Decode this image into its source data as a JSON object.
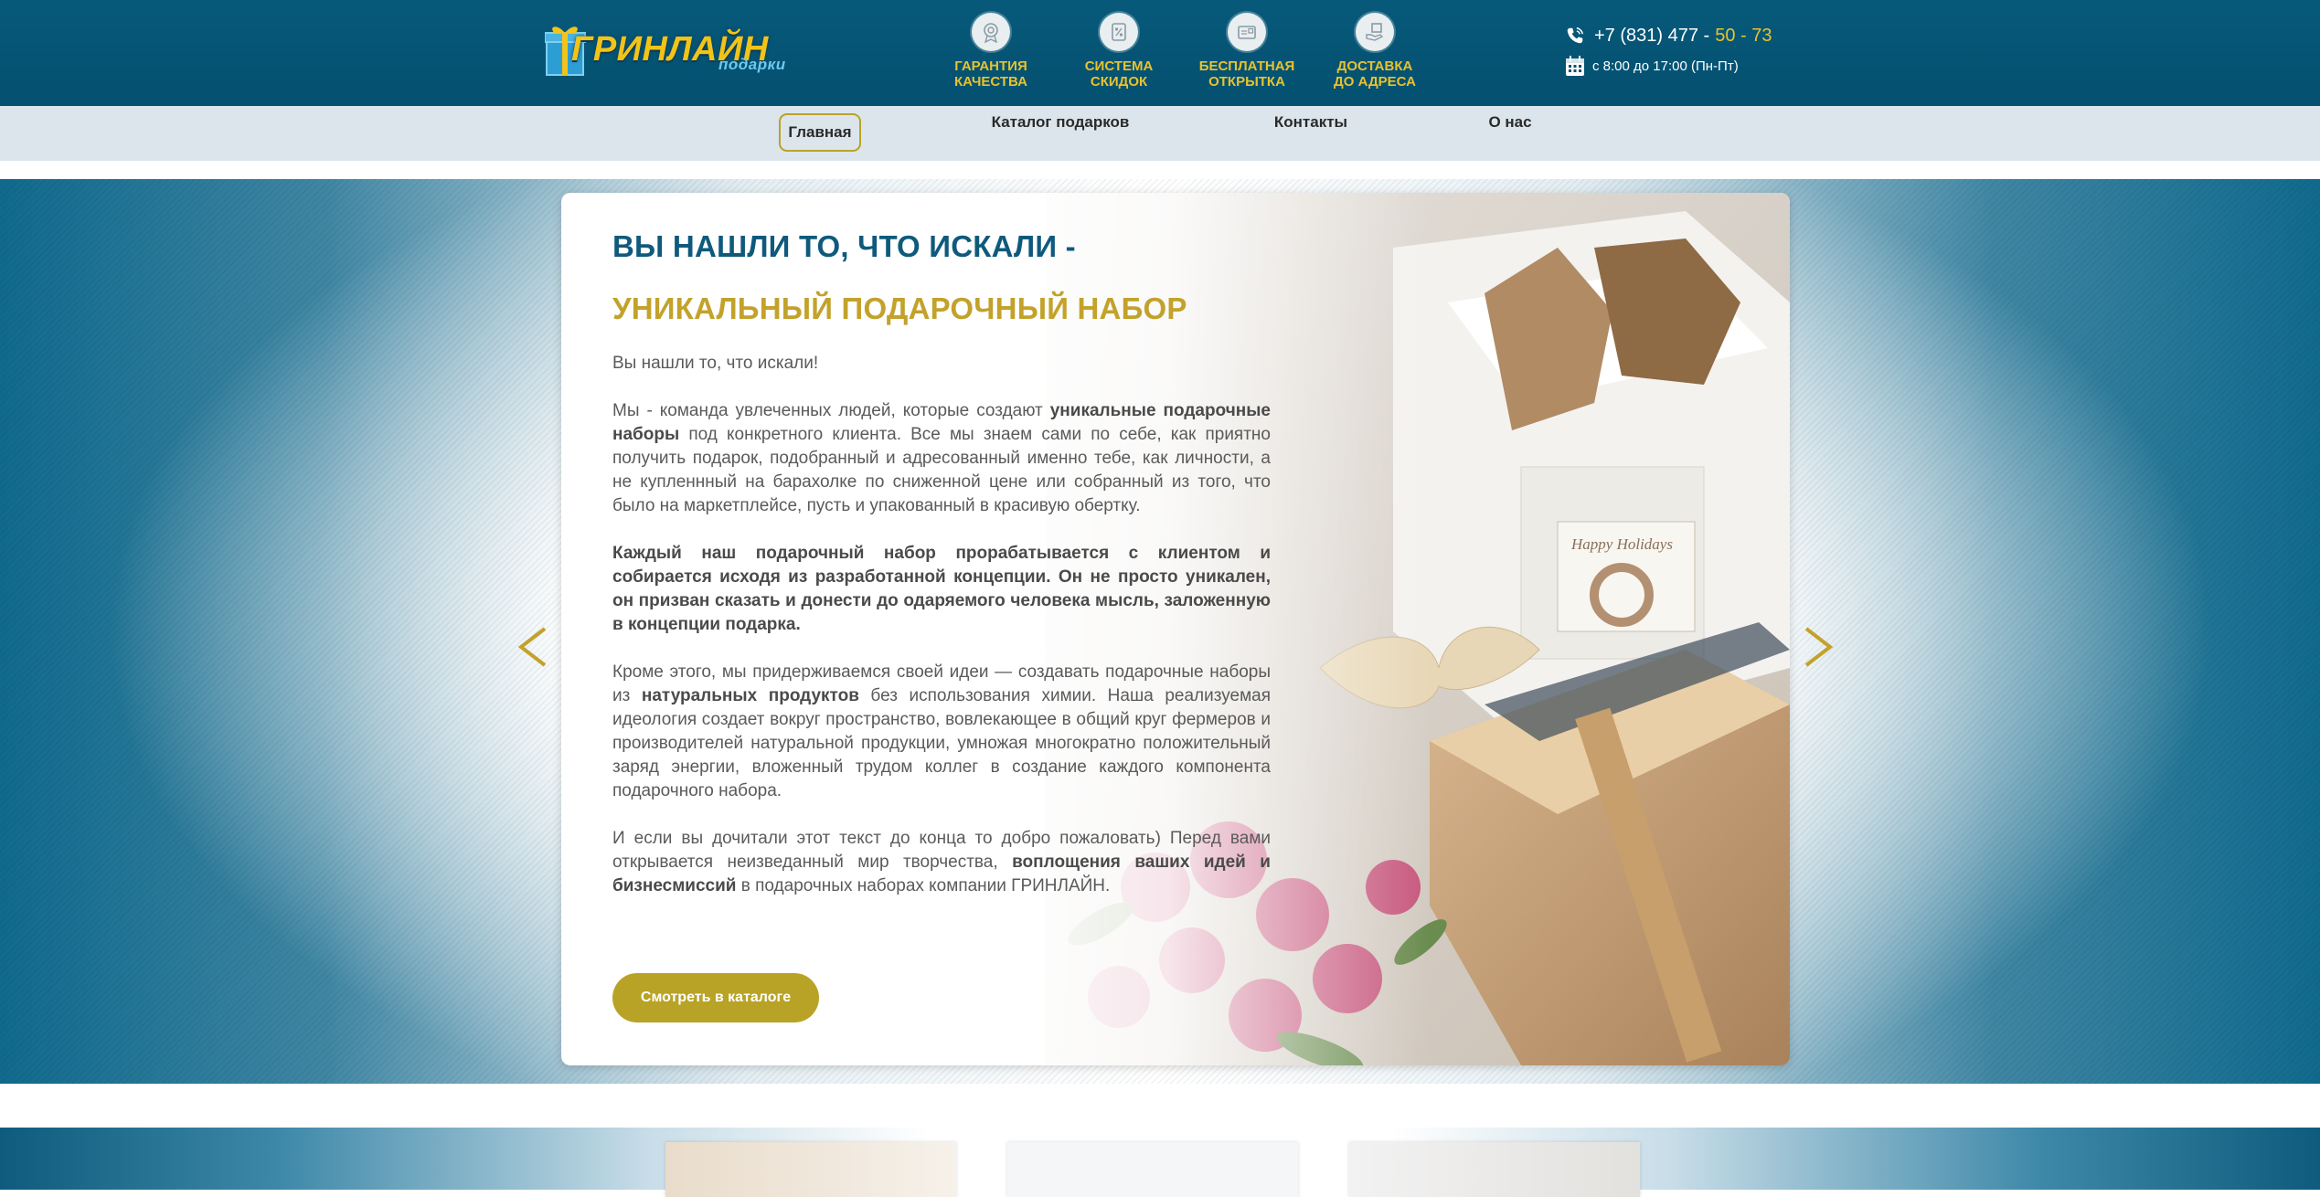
{
  "brand": {
    "logo_main": "ГРИНЛАЙН",
    "logo_sub": "подарки"
  },
  "features": [
    {
      "label": "ГАРАНТИЯ\nКАЧЕСТВА",
      "icon": "quality-badge-icon"
    },
    {
      "label": "СИСТЕМА\nСКИДОК",
      "icon": "discount-percent-icon"
    },
    {
      "label": "БЕСПЛАТНАЯ\nОТКРЫТКА",
      "icon": "postcard-icon"
    },
    {
      "label": "ДОСТАВКА\nДО АДРЕСА",
      "icon": "delivery-hand-icon"
    }
  ],
  "contact": {
    "phone_main": "+7 (831) 477 -",
    "phone_accent": "50 - 73",
    "hours": "с 8:00 до 17:00 (Пн-Пт)"
  },
  "nav": {
    "items": [
      {
        "label": "Главная",
        "active": true
      },
      {
        "label": "Каталог подарков",
        "active": false
      },
      {
        "label": "Контакты",
        "active": false
      },
      {
        "label": "О нас",
        "active": false
      }
    ]
  },
  "hero": {
    "title_line1": "ВЫ НАШЛИ ТО, ЧТО ИСКАЛИ -",
    "title_line2": "УНИКАЛЬНЫЙ ПОДАРОЧНЫЙ НАБОР",
    "intro": "Вы нашли то, что искали!",
    "p1_a": "Мы - команда увлеченных людей, которые создают ",
    "p1_b": "уникальные подарочные наборы",
    "p1_c": " под конкретного клиента. Все мы знаем сами по себе, как приятно получить подарок, подобранный и адресованный именно тебе, как личности, а не купленнный на барахолке по сниженной цене или собранный из того, что было на маркетплейсе, пусть и упакованный в красивую обертку.",
    "p2": "Каждый наш подарочный набор прорабатывается с клиентом и собирается исходя из разработанной концепции. Он не просто уникален, он призван сказать и донести до одаряемого человека мысль, заложенную в концепции подарка.",
    "p3_a": "Кроме этого, мы придерживаемся своей идеи  — создавать подарочные наборы из ",
    "p3_b": "натуральных продуктов",
    "p3_c": " без использования химии. Наша реализуемая идеология создает вокруг пространство, вовлекающее в общий круг фермеров и производителей натуральной продукции, умножая многократно положительный заряд энергии, вложенный трудом коллег в создание каждого компонента подарочного набора.",
    "p4_a": "И если вы дочитали этот текст до конца то добро пожаловать) Перед вами открывается неизведанный мир творчества, ",
    "p4_b": "воплощения ваших идей и бизнесмиссий",
    "p4_c": " в подарочных наборах компании ГРИНЛАЙН.",
    "button_label": "Смотреть в каталоге",
    "card_text": "Happy Holidays"
  },
  "colors": {
    "header_bg": "#045070",
    "accent_gold": "#b9a326",
    "title_blue": "#0f5a7c",
    "title_gold": "#c3a22b",
    "nav_bg": "#dce5ec"
  }
}
